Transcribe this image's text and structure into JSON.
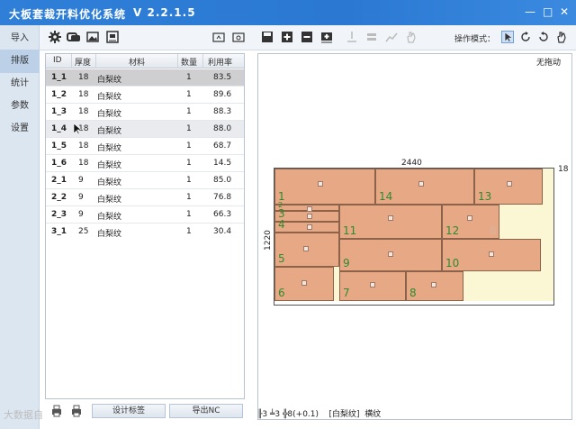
{
  "app": {
    "title": "大板套裁开料优化系统",
    "version": "V 2.2.1.5"
  },
  "window_controls": {
    "minimize": "—",
    "maximize": "□",
    "close": "✕"
  },
  "sidebar": {
    "items": [
      {
        "label": "导入",
        "active": false
      },
      {
        "label": "排版",
        "active": true
      },
      {
        "label": "统计",
        "active": false
      },
      {
        "label": "参数",
        "active": false
      },
      {
        "label": "设置",
        "active": false
      }
    ]
  },
  "toolbar": {
    "mode_label": "操作模式："
  },
  "table": {
    "headers": [
      "ID",
      "厚度",
      "材料",
      "数量",
      "利用率"
    ],
    "rows": [
      {
        "id": "1_1",
        "thickness": "18",
        "material": "白梨纹",
        "qty": "1",
        "util": "83.5"
      },
      {
        "id": "1_2",
        "thickness": "18",
        "material": "白梨纹",
        "qty": "1",
        "util": "89.6"
      },
      {
        "id": "1_3",
        "thickness": "18",
        "material": "白梨纹",
        "qty": "1",
        "util": "88.3"
      },
      {
        "id": "1_4",
        "thickness": "18",
        "material": "白梨纹",
        "qty": "1",
        "util": "88.0"
      },
      {
        "id": "1_5",
        "thickness": "18",
        "material": "白梨纹",
        "qty": "1",
        "util": "68.7"
      },
      {
        "id": "1_6",
        "thickness": "18",
        "material": "白梨纹",
        "qty": "1",
        "util": "14.5"
      },
      {
        "id": "2_1",
        "thickness": "9",
        "material": "白梨纹",
        "qty": "1",
        "util": "85.0"
      },
      {
        "id": "2_2",
        "thickness": "9",
        "material": "白梨纹",
        "qty": "1",
        "util": "76.8"
      },
      {
        "id": "2_3",
        "thickness": "9",
        "material": "白梨纹",
        "qty": "1",
        "util": "66.3"
      },
      {
        "id": "3_1",
        "thickness": "25",
        "material": "白梨纹",
        "qty": "1",
        "util": "30.4"
      }
    ]
  },
  "buttons": {
    "design_label": "设计标签",
    "export_nc": "导出NC"
  },
  "watermark": "大数据自",
  "canvas": {
    "mode_text": "无拖动",
    "board_width": "2440",
    "board_height": "1220",
    "thickness": "18",
    "pieces": [
      "1",
      "2",
      "3",
      "4",
      "5",
      "6",
      "7",
      "8",
      "9",
      "10",
      "11",
      "12",
      "13",
      "14"
    ]
  },
  "status": {
    "text1": "╟3 ╧3 ╬8(+0.1)",
    "material": "[白梨纹]",
    "grain": "横纹"
  }
}
